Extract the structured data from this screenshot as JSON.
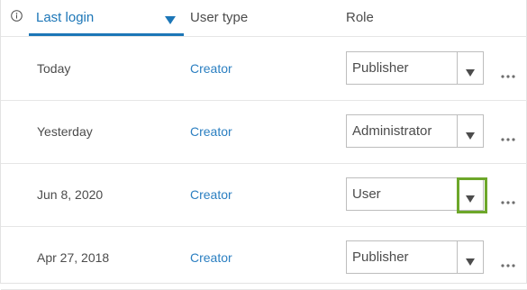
{
  "header": {
    "last_login_label": "Last login",
    "user_type_label": "User type",
    "role_label": "Role",
    "info_icon": "info-icon",
    "sort_icon": "sort-descending-icon"
  },
  "rows": [
    {
      "last_login": "Today",
      "user_type": "Creator",
      "role": "Publisher"
    },
    {
      "last_login": "Yesterday",
      "user_type": "Creator",
      "role": "Administrator"
    },
    {
      "last_login": "Jun 8, 2020",
      "user_type": "Creator",
      "role": "User"
    },
    {
      "last_login": "Apr 27, 2018",
      "user_type": "Creator",
      "role": "Publisher"
    }
  ],
  "colors": {
    "accent": "#1c76b7",
    "link": "#2b7fc1",
    "highlight": "#6da72a",
    "text": "#4c4c4c",
    "border": "#bdbdbd"
  }
}
